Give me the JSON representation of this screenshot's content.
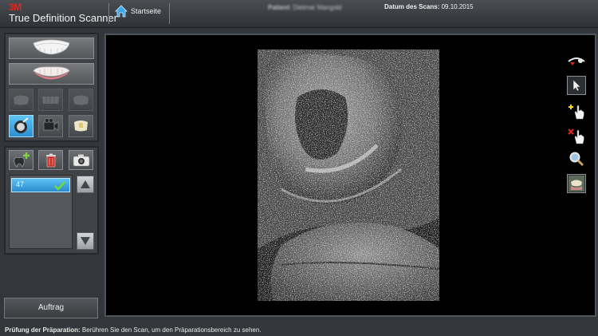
{
  "header": {
    "brand_mark": "3M",
    "brand_title": "True Definition Scanner",
    "home_label": "Startseite",
    "patient_label": "Patient:",
    "patient_name": "Dietmar Mangold",
    "scan_date_label": "Datum des Scans:",
    "scan_date": "09.10.2015"
  },
  "left_panel": {
    "view_buttons": [
      {
        "icon": "upper-jaw-icon"
      },
      {
        "icon": "lower-jaw-icon"
      }
    ],
    "jaw_views": [
      {
        "icon": "jaw-left-icon",
        "enabled": false
      },
      {
        "icon": "jaw-front-icon",
        "enabled": false
      },
      {
        "icon": "jaw-right-icon",
        "enabled": false
      }
    ],
    "mode_buttons": [
      {
        "icon": "preparation-check-icon",
        "active": true
      },
      {
        "icon": "video-camera-icon",
        "active": false
      },
      {
        "icon": "tooth-prep-icon",
        "active": false
      }
    ],
    "tools": [
      {
        "icon": "add-tooth-icon"
      },
      {
        "icon": "trash-icon"
      },
      {
        "icon": "camera-icon"
      }
    ],
    "list": {
      "items": [
        {
          "label": "47",
          "status": "checkmark-icon"
        }
      ]
    },
    "scroll_up_icon": "triangle-up-icon",
    "scroll_down_icon": "triangle-down-icon",
    "order_label": "Auftrag"
  },
  "right_toolbar": [
    {
      "icon": "view-reset-icon"
    },
    {
      "icon": "pointer-icon"
    },
    {
      "icon": "add-region-hand-icon"
    },
    {
      "icon": "remove-region-hand-icon"
    },
    {
      "icon": "magnifier-icon"
    },
    {
      "icon": "tooth-thumbnail-icon"
    }
  ],
  "status": {
    "label": "Prüfung der Präparation:",
    "message": "Berühren Sie den Scan, um den Präparationsbereich zu sehen."
  },
  "colors": {
    "accent_blue": "#3fa8e8",
    "brand_red": "#e0261c",
    "viewport_bg": "#000000",
    "panel_bg": "#3f4347"
  }
}
